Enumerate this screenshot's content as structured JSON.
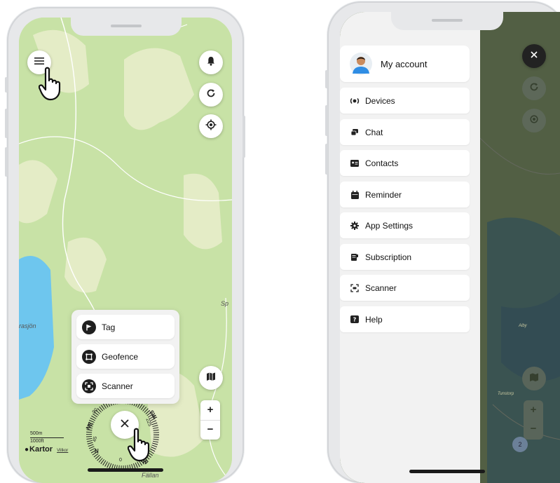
{
  "left_phone": {
    "map": {
      "place_labels": [
        "Sp",
        "rasjön",
        "Fällan"
      ],
      "scale_bar": {
        "metric": "500m",
        "imperial": "1000ft"
      },
      "attribution": {
        "brand": "Kartor",
        "terms": "Villkor"
      }
    },
    "controls": {
      "menu_icon": "hamburger-icon",
      "bell_icon": "bell-icon",
      "refresh_icon": "refresh-icon",
      "locate_icon": "locate-icon",
      "layers_icon": "map-icon",
      "zoom_in": "+",
      "zoom_out": "−",
      "close_icon": "close-icon"
    },
    "action_menu": [
      {
        "label": "Tag",
        "icon": "flag-icon"
      },
      {
        "label": "Geofence",
        "icon": "geofence-icon"
      },
      {
        "label": "Scanner",
        "icon": "scanner-icon"
      }
    ],
    "compass_labels": [
      "NE",
      "N",
      "NW",
      "SW",
      "45",
      "90",
      "135",
      "180",
      "225",
      "0"
    ]
  },
  "right_phone": {
    "account_label": "My account",
    "menu_items": [
      {
        "label": "Devices",
        "icon": "devices-icon"
      },
      {
        "label": "Chat",
        "icon": "chat-icon"
      },
      {
        "label": "Contacts",
        "icon": "contacts-icon"
      },
      {
        "label": "Reminder",
        "icon": "calendar-icon"
      },
      {
        "label": "App Settings",
        "icon": "gear-icon"
      },
      {
        "label": "Subscription",
        "icon": "subscription-icon"
      },
      {
        "label": "Scanner",
        "icon": "scanner-icon"
      },
      {
        "label": "Help",
        "icon": "help-icon"
      }
    ],
    "zoom_in": "+",
    "zoom_out": "−",
    "map_labels": [
      "Tunstorp",
      "Alby"
    ],
    "cluster_count": "2"
  },
  "colors": {
    "map_green": "#c8e2a6",
    "forest": "#e4ecc6",
    "water": "#6ec6ee",
    "menu_bg": "#f2f2f2",
    "overlay": "rgba(30,40,30,0.55)"
  }
}
